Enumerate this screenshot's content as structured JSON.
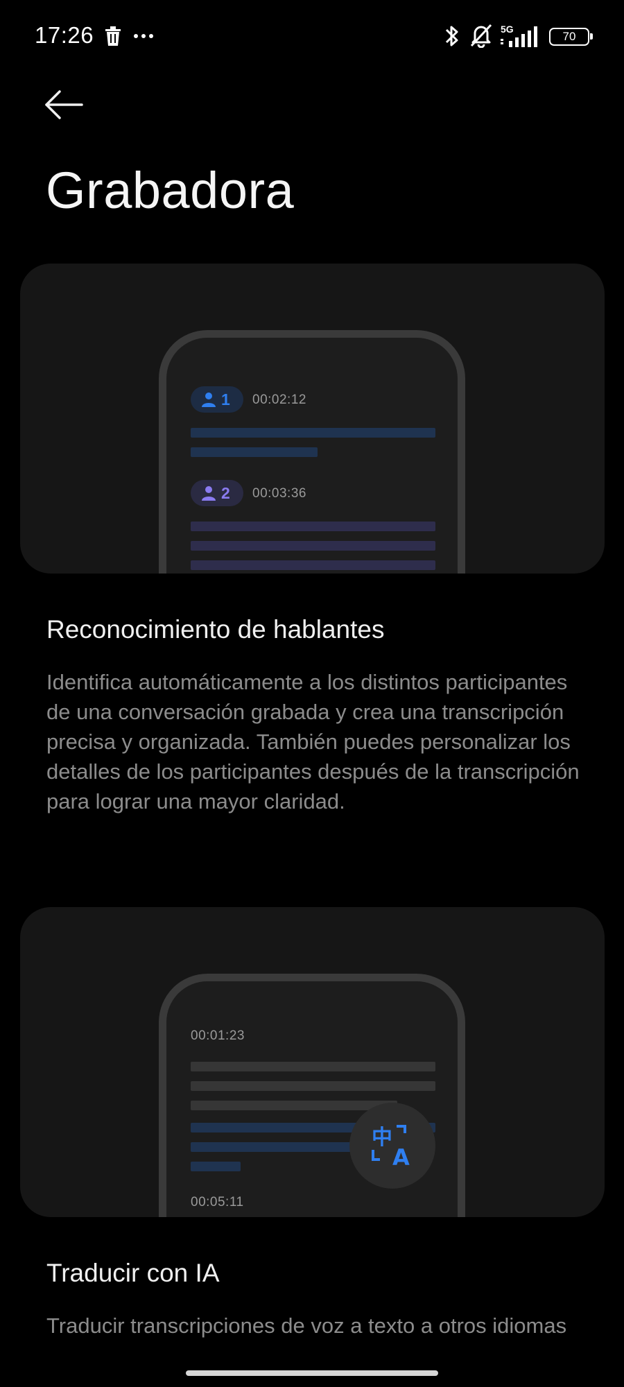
{
  "status_bar": {
    "time": "17:26",
    "battery": "70",
    "network": "5G",
    "icons": [
      "trash-icon",
      "more-dots-icon",
      "bluetooth-icon",
      "bell-off-icon",
      "signal-icon",
      "battery-icon"
    ]
  },
  "header": {
    "back_icon": "back-arrow-icon",
    "title": "Grabadora"
  },
  "features": [
    {
      "illustration": {
        "speakers": [
          {
            "number": "1",
            "time": "00:02:12",
            "color": "#2f7ff0"
          },
          {
            "number": "2",
            "time": "00:03:36",
            "color": "#8a7bf0"
          }
        ]
      },
      "heading": "Reconocimiento de hablantes",
      "description": "Identifica automáticamente a los distintos participantes de una conversación grabada y crea una transcripción precisa y organizada. También puedes personalizar los detalles de los participantes después de la transcripción para lograr una mayor claridad."
    },
    {
      "illustration": {
        "times": [
          "00:01:23",
          "00:05:11"
        ],
        "fab_icon": "translate-icon",
        "fab_glyphs": [
          "中",
          "A"
        ]
      },
      "heading": "Traducir con IA",
      "description": "Traducir transcripciones de voz a texto a otros idiomas"
    }
  ],
  "colors": {
    "background": "#000000",
    "card": "#161616",
    "accent_blue": "#2f7ff0",
    "accent_purple": "#8a7bf0"
  }
}
